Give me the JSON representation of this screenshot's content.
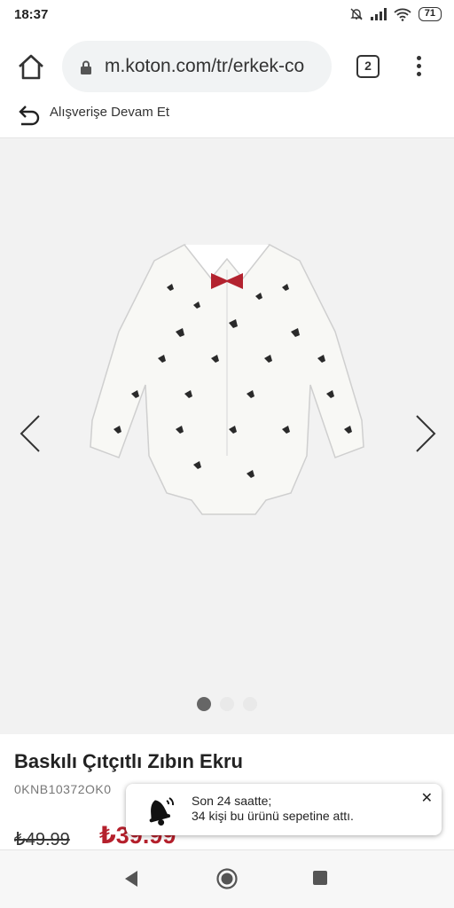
{
  "status": {
    "time": "18:37",
    "battery": "71"
  },
  "browser": {
    "url": "m.koton.com/tr/erkek-co",
    "tab_count": "2"
  },
  "nav": {
    "continue_label": "Alışverişe Devam Et"
  },
  "gallery": {
    "slide_count": 3,
    "active_slide": 1
  },
  "product": {
    "title": "Baskılı Çıtçıtlı Zıbın Ekru",
    "sku": "0KNB10372OK0",
    "old_price": "₺49.99",
    "new_price": "₺39.99"
  },
  "toast": {
    "line1": "Son 24 saatte;",
    "line2": "34 kişi bu ürünü sepetine attı.",
    "close_label": "✕"
  },
  "colors": {
    "price_red": "#b5202c",
    "bow_red": "#b3232f"
  },
  "icons": [
    "home-icon",
    "lock-icon",
    "tabs-icon",
    "menu-icon",
    "back-arrow-icon",
    "chevron-left-icon",
    "chevron-right-icon",
    "bell-icon",
    "close-icon",
    "nav-back-icon",
    "nav-home-icon",
    "nav-recents-icon"
  ]
}
